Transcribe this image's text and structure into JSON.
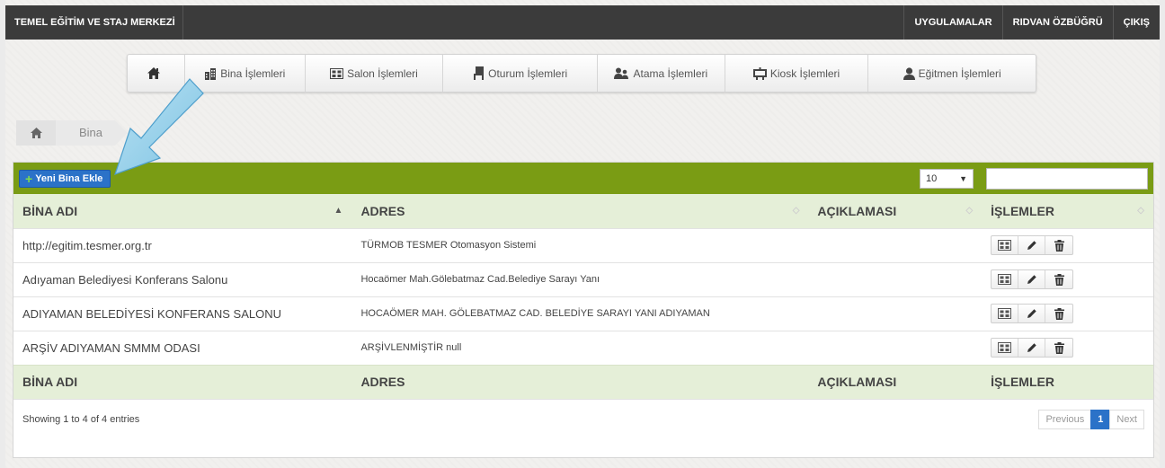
{
  "topbar": {
    "brand": "TEMEL EĞİTİM VE STAJ MERKEZİ",
    "nav": [
      "UYGULAMALAR",
      "RIDVAN ÖZBÜĞRÜ",
      "ÇIKIŞ"
    ]
  },
  "menu": {
    "bina": "Bina İşlemleri",
    "salon": "Salon İşlemleri",
    "oturum": "Oturum İşlemleri",
    "atama": "Atama İşlemleri",
    "kiosk": "Kiosk İşlemleri",
    "egitmen": "Eğitmen İşlemleri"
  },
  "breadcrumb": {
    "current": "Bina"
  },
  "toolbar": {
    "add_label": "Yeni Bina Ekle",
    "page_length": "10",
    "search_value": ""
  },
  "table": {
    "headers": [
      "BİNA ADI",
      "ADRES",
      "AÇIKLAMASI",
      "İŞLEMLER"
    ],
    "rows": [
      {
        "name": "http://egitim.tesmer.org.tr",
        "address": "TÜRMOB TESMER Otomasyon Sistemi",
        "desc": ""
      },
      {
        "name": "Adıyaman Belediyesi Konferans Salonu",
        "address": "Hocaömer Mah.Gölebatmaz Cad.Belediye Sarayı Yanı",
        "desc": ""
      },
      {
        "name": "ADIYAMAN BELEDİYESİ KONFERANS SALONU",
        "address": "HOCAÖMER MAH. GÖLEBATMAZ CAD. BELEDİYE SARAYI YANI ADIYAMAN",
        "desc": ""
      },
      {
        "name": "ARŞİV ADIYAMAN SMMM ODASI",
        "address": "ARŞİVLENMİŞTİR null",
        "desc": ""
      }
    ]
  },
  "footer": {
    "info": "Showing 1 to 4 of 4 entries",
    "prev": "Previous",
    "page": "1",
    "next": "Next"
  },
  "colors": {
    "topbar": "#3b3b3b",
    "panel_header": "#7a9c14",
    "primary": "#2b72c8",
    "table_header": "#e5efd8",
    "arrow": "#8ccbe8"
  }
}
